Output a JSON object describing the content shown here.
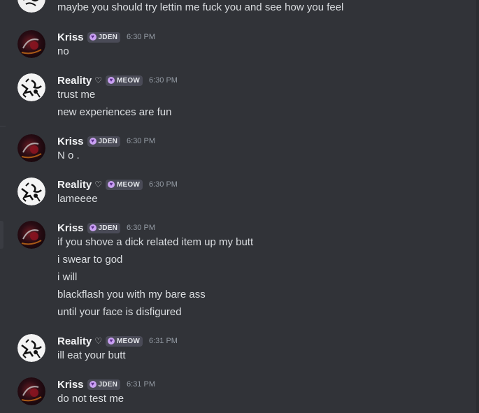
{
  "colors": {
    "background": "#313338",
    "username": "#f2f3f5",
    "message_text": "#dbdee1",
    "timestamp": "#949ba4",
    "tag_background": "#4a4b57",
    "tag_icon": "#c9a0f2"
  },
  "top_partial": {
    "text": "maybe you should try lettin me fuck you and see how you feel"
  },
  "messages": [
    {
      "author": "Kriss",
      "heart": "",
      "tag_icon": "heart-icon",
      "tag": "JDEN",
      "time": "6:30 PM",
      "lines": [
        "no"
      ]
    },
    {
      "author": "Reality",
      "heart": "♡",
      "tag_icon": "heart-icon",
      "tag": "MEOW",
      "time": "6:30 PM",
      "lines": [
        "trust me",
        "new experiences are fun"
      ]
    },
    {
      "author": "Kriss",
      "heart": "",
      "tag_icon": "heart-icon",
      "tag": "JDEN",
      "time": "6:30 PM",
      "lines": [
        "N o ."
      ]
    },
    {
      "author": "Reality",
      "heart": "♡",
      "tag_icon": "heart-icon",
      "tag": "MEOW",
      "time": "6:30 PM",
      "lines": [
        "lameeee"
      ]
    },
    {
      "author": "Kriss",
      "heart": "",
      "tag_icon": "heart-icon",
      "tag": "JDEN",
      "time": "6:30 PM",
      "lines": [
        "if you shove a dick related item up my butt",
        "i swear to god",
        "i will",
        "blackflash you with my bare ass",
        "until your face is disfigured"
      ]
    },
    {
      "author": "Reality",
      "heart": "♡",
      "tag_icon": "heart-icon",
      "tag": "MEOW",
      "time": "6:31 PM",
      "lines": [
        "ill eat your butt"
      ]
    },
    {
      "author": "Kriss",
      "heart": "",
      "tag_icon": "heart-icon",
      "tag": "JDEN",
      "time": "6:31 PM",
      "lines": [
        "do not test me"
      ]
    }
  ]
}
